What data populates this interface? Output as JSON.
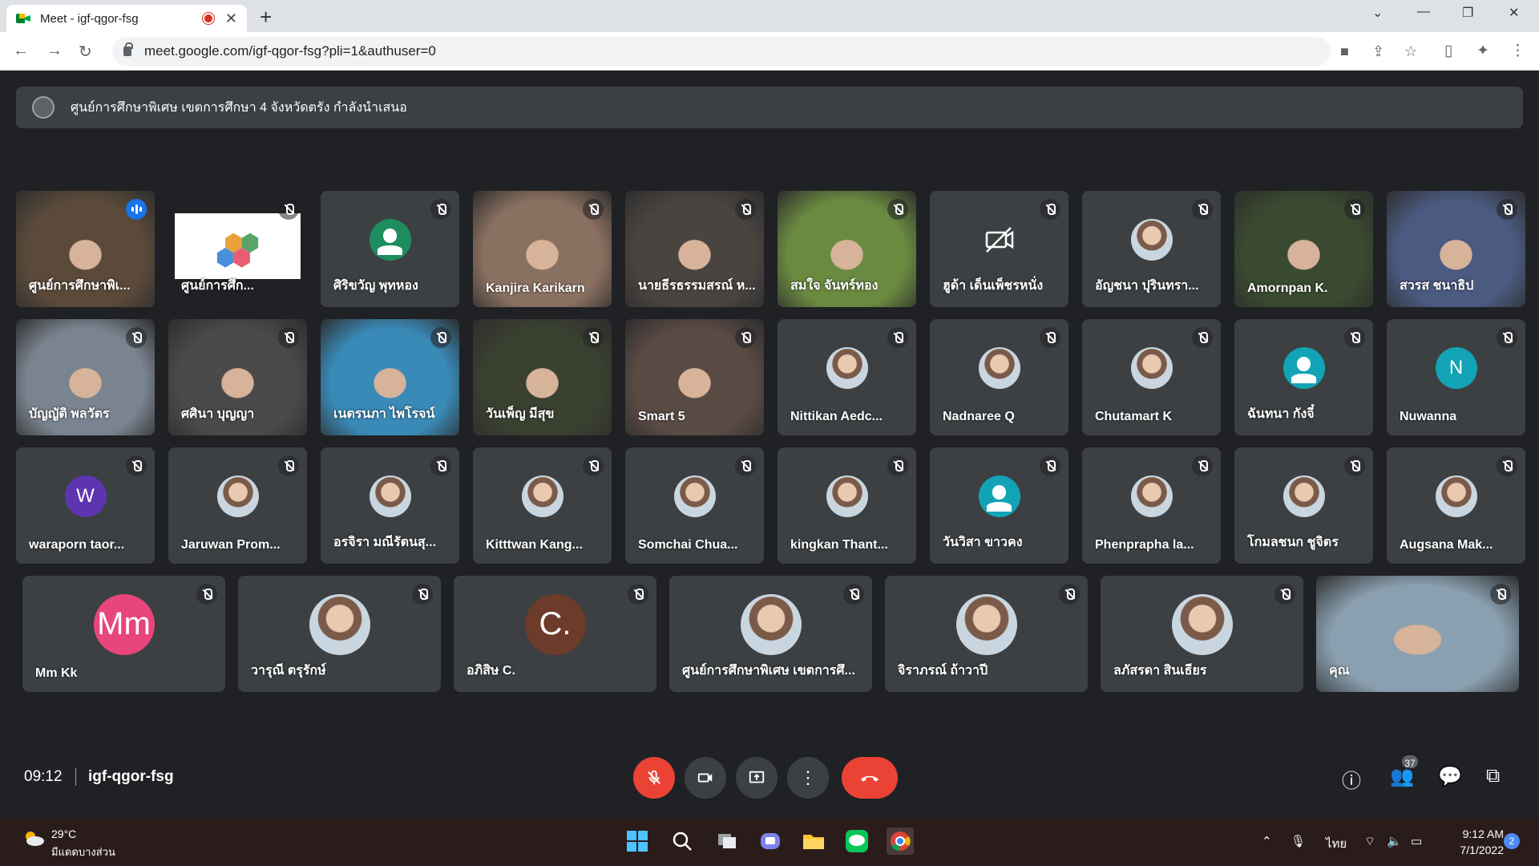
{
  "browser": {
    "tab_title": "Meet - igf-qgor-fsg",
    "tab_close": "✕",
    "new_tab": "+",
    "url": "meet.google.com/igf-qgor-fsg?pli=1&authuser=0"
  },
  "banner": {
    "text": "ศูนย์การศึกษาพิเศษ เขตการศึกษา 4 จังหวัดตรัง กำลังนำเสนอ"
  },
  "participants": [
    {
      "name": "ศูนย์การศึกษาพิเ...",
      "type": "video",
      "color": "#5b4a3a",
      "speaking": true
    },
    {
      "name": "ศูนย์การศึก...",
      "type": "screen",
      "color": "#ffffff"
    },
    {
      "name": "ศิริขวัญ พุทหอง",
      "type": "icon"
    },
    {
      "name": "Kanjira Karikarn",
      "type": "video",
      "color": "#8a7060"
    },
    {
      "name": "นายธีรธรรมสรณ์ ห...",
      "type": "video",
      "color": "#4a4440"
    },
    {
      "name": "สมใจ จันทร์ทอง",
      "type": "video",
      "color": "#6a8a40"
    },
    {
      "name": "ฮูด้า เด็นเพ็ชรหนั่ง",
      "type": "camoff"
    },
    {
      "name": "อัญชนา ปุรินทรา...",
      "type": "photo"
    },
    {
      "name": "Amornpan K.",
      "type": "video",
      "color": "#3a4a30"
    },
    {
      "name": "สวรส ชนาธิป",
      "type": "video",
      "color": "#4a5a80"
    },
    {
      "name": "บัญญัติ พลวัตร",
      "type": "video",
      "color": "#7a8490"
    },
    {
      "name": "ศศินา บุญญา",
      "type": "video",
      "color": "#4a4a4a"
    },
    {
      "name": "เนตรนภา ไพโรจน์",
      "type": "video",
      "color": "#3a8ab8"
    },
    {
      "name": "วันเพ็ญ มีสุข",
      "type": "video",
      "color": "#3a4030"
    },
    {
      "name": "Smart 5",
      "type": "video",
      "color": "#5a4a44"
    },
    {
      "name": "Nittikan Aedc...",
      "type": "photo"
    },
    {
      "name": "Nadnaree Q",
      "type": "photo"
    },
    {
      "name": "Chutamart K",
      "type": "photo"
    },
    {
      "name": "ฉันทนา กังจี๋",
      "type": "teal"
    },
    {
      "name": "Nuwanna",
      "type": "letter",
      "letter": "N",
      "color": "#12a4b6"
    },
    {
      "name": "waraporn taor...",
      "type": "letter",
      "letter": "W",
      "color": "#5e35b1"
    },
    {
      "name": "Jaruwan Prom...",
      "type": "photo"
    },
    {
      "name": "อรจิรา มณีรัตนสุ...",
      "type": "photo"
    },
    {
      "name": "Kitttwan Kang...",
      "type": "photo"
    },
    {
      "name": "Somchai Chua...",
      "type": "photo"
    },
    {
      "name": "kingkan Thant...",
      "type": "photo"
    },
    {
      "name": "วันวิสา ขาวคง",
      "type": "teal"
    },
    {
      "name": "Phenprapha la...",
      "type": "photo"
    },
    {
      "name": "โกมลชนก ชูจิตร",
      "type": "photo"
    },
    {
      "name": "Augsana Mak...",
      "type": "photo"
    },
    {
      "name": "Mm Kk",
      "type": "letter",
      "letter": "Mm",
      "color": "#e8457b"
    },
    {
      "name": "วารุณี ตรุรักษ์",
      "type": "photo"
    },
    {
      "name": "อภิสิษ C.",
      "type": "letter",
      "letter": "C.",
      "color": "#6d3b2a"
    },
    {
      "name": "ศูนย์การศึกษาพิเศษ เขตการศึ...",
      "type": "photo"
    },
    {
      "name": "จิราภรณ์ ถ้าวาปี",
      "type": "photo"
    },
    {
      "name": "ลภัสรดา สินเธียร",
      "type": "photo"
    },
    {
      "name": "คุณ",
      "type": "video",
      "color": "#8aa0b0"
    }
  ],
  "footer": {
    "time": "09:12",
    "meeting_code": "igf-qgor-fsg",
    "participant_count": "37"
  },
  "taskbar": {
    "temperature": "29°C",
    "condition": "มีแดดบางส่วน",
    "language": "ไทย",
    "time": "9:12 AM",
    "date": "7/1/2022",
    "notification_count": "2"
  },
  "colors": {
    "meet_bg": "#202124",
    "tile_bg": "#3c4043",
    "end_call": "#ea4335",
    "active_outline": "#8ab4f8"
  }
}
